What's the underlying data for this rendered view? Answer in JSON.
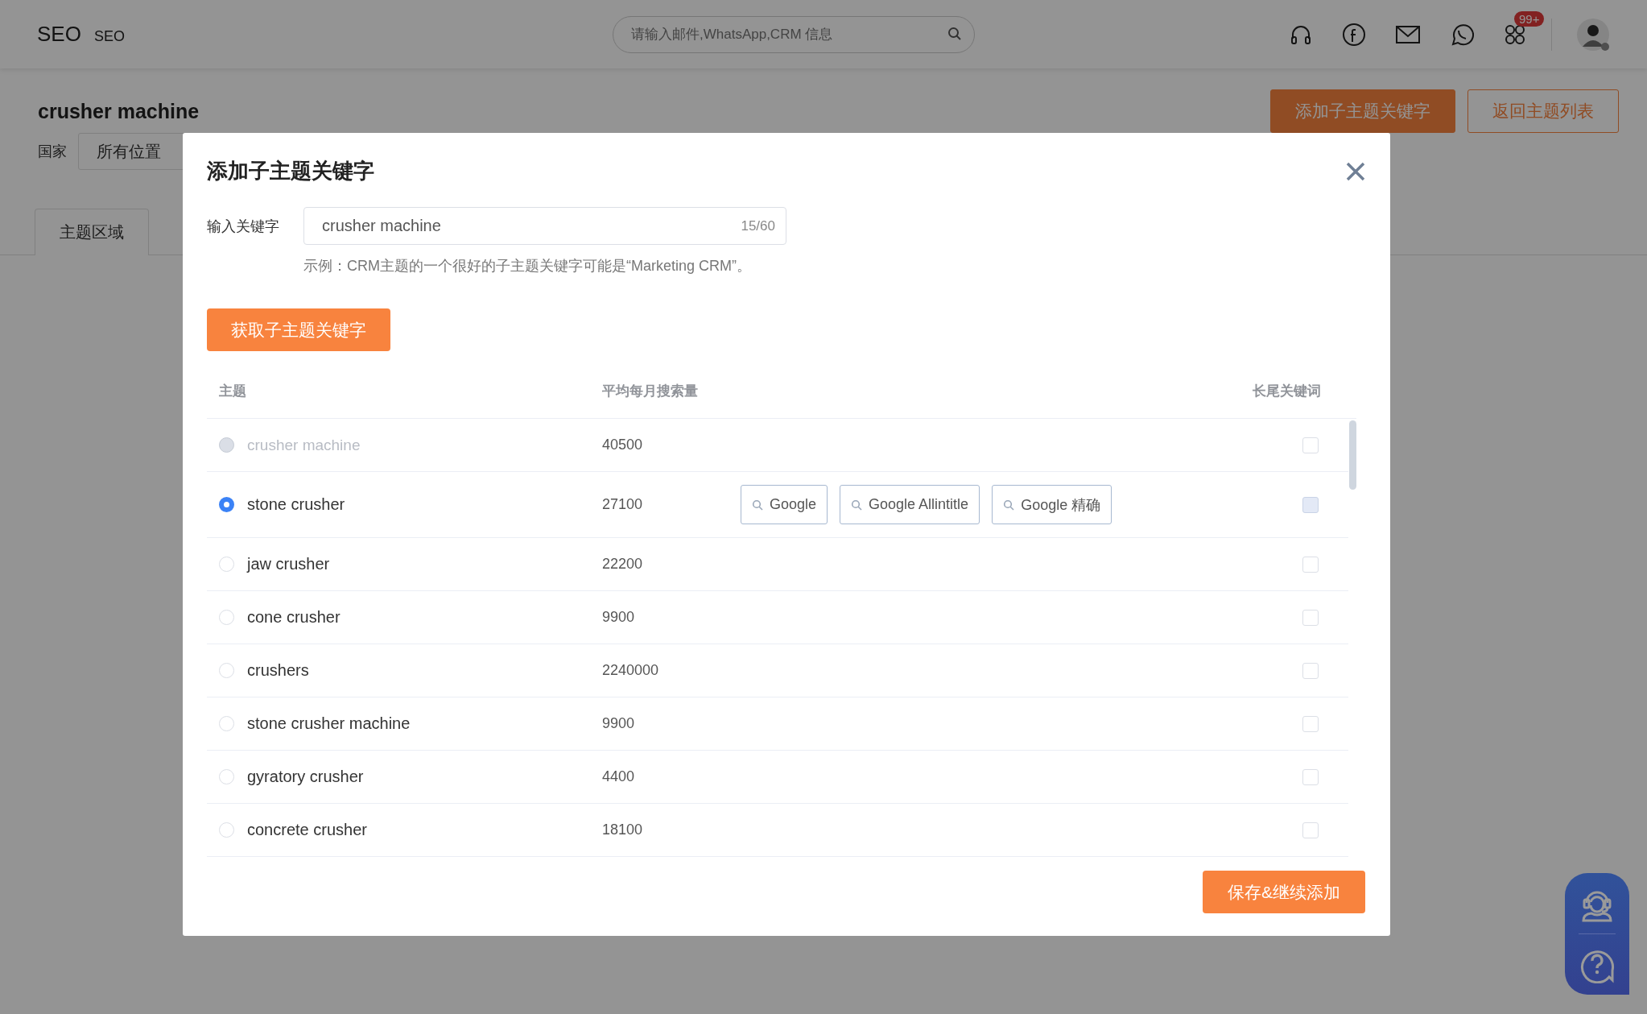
{
  "header": {
    "logo": "SEO",
    "logo_sub": "SEO",
    "search": {
      "placeholder": "请输入邮件,WhatsApp,CRM 信息"
    },
    "badge": "99+"
  },
  "page": {
    "title": "crusher machine",
    "buttons": [
      {
        "label": "添加子主题关键字",
        "kind": "primary"
      },
      {
        "label": "返回主题列表",
        "kind": "outline"
      }
    ],
    "country_label": "国家",
    "country_value": "所有位置",
    "tabs": [
      {
        "label": "主题区域",
        "selected": true
      }
    ]
  },
  "dialog": {
    "title": "添加子主题关键字",
    "field_label": "输入关键字",
    "field_value": "crusher machine",
    "counter": "15/60",
    "hint": "示例：CRM主题的一个很好的子主题关键字可能是“Marketing CRM”。",
    "fetch_button": "获取子主题关键字",
    "table": {
      "columns": [
        "主题",
        "平均每月搜索量",
        "长尾关键词"
      ],
      "rows": [
        {
          "topic": "crusher machine",
          "volume": "40500",
          "selected": false,
          "disabled": true,
          "longtail_checked": false,
          "longtail_disabled": false
        },
        {
          "topic": "stone crusher",
          "volume": "27100",
          "selected": true,
          "disabled": false,
          "longtail_checked": false,
          "longtail_disabled": true,
          "search_buttons": [
            "Google",
            "Google Allintitle",
            "Google 精确"
          ]
        },
        {
          "topic": "jaw crusher",
          "volume": "22200",
          "selected": false,
          "disabled": false,
          "longtail_checked": false,
          "longtail_disabled": false
        },
        {
          "topic": "cone crusher",
          "volume": "9900",
          "selected": false,
          "disabled": false,
          "longtail_checked": false,
          "longtail_disabled": false
        },
        {
          "topic": "crushers",
          "volume": "2240000",
          "selected": false,
          "disabled": false,
          "longtail_checked": false,
          "longtail_disabled": false
        },
        {
          "topic": "stone crusher machine",
          "volume": "9900",
          "selected": false,
          "disabled": false,
          "longtail_checked": false,
          "longtail_disabled": false
        },
        {
          "topic": "gyratory crusher",
          "volume": "4400",
          "selected": false,
          "disabled": false,
          "longtail_checked": false,
          "longtail_disabled": false
        },
        {
          "topic": "concrete crusher",
          "volume": "18100",
          "selected": false,
          "disabled": false,
          "longtail_checked": false,
          "longtail_disabled": false
        }
      ]
    },
    "save_button": "保存&继续添加"
  }
}
